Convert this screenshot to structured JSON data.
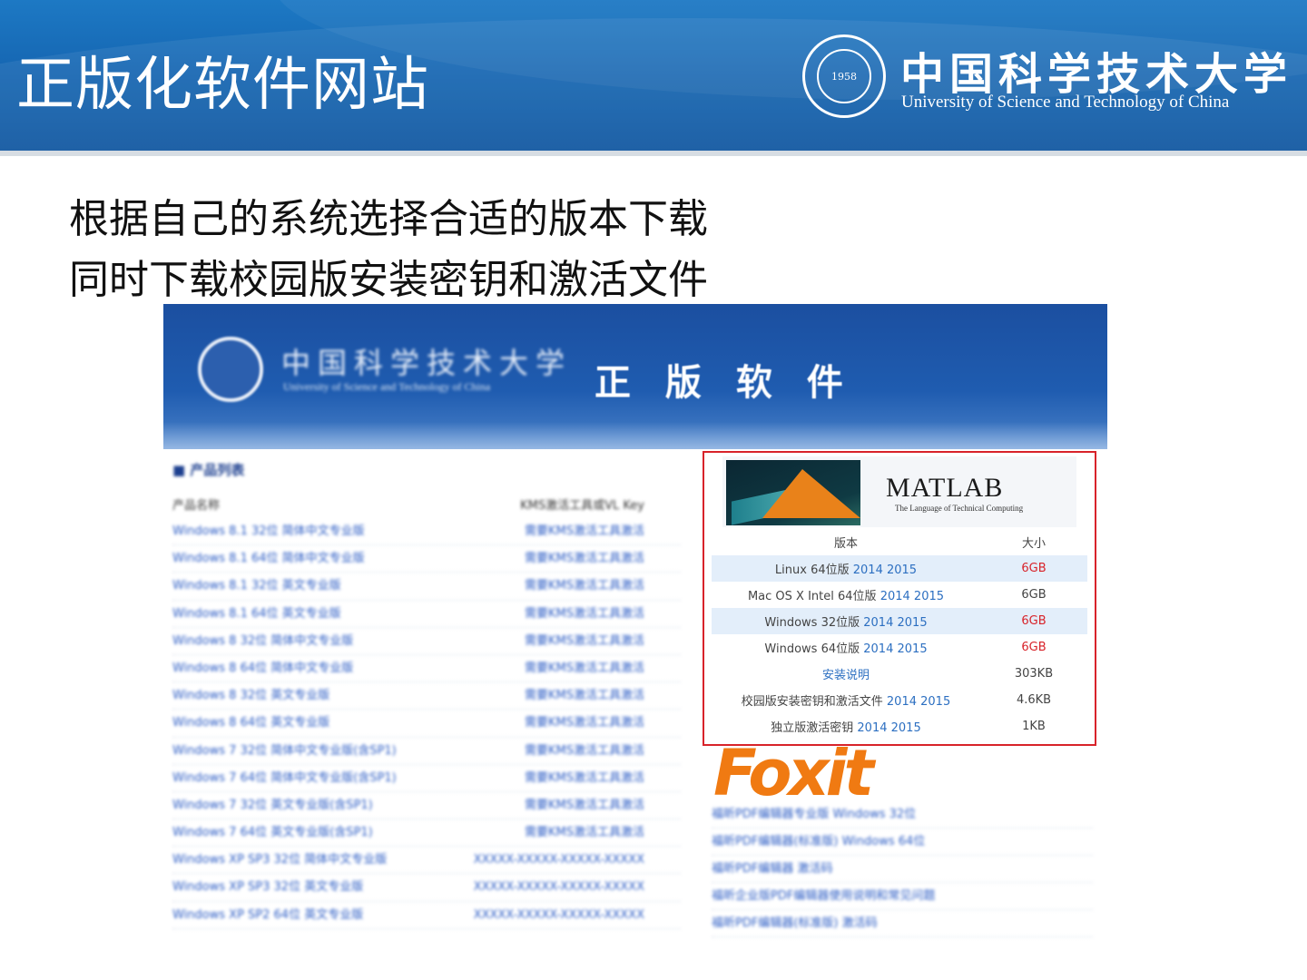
{
  "slide": {
    "title": "正版化软件网站",
    "logo_cn": "中国科学技术大学",
    "logo_en": "University of Science and Technology of China",
    "seal_year": "1958",
    "line1": "根据自己的系统选择合适的版本下载",
    "line2": "同时下载校园版安装密钥和激活文件"
  },
  "site": {
    "name_cn": "中国科学技术大学",
    "name_en": "University of Science and Technology of China",
    "section_title": "正 版 软 件",
    "product_list_heading": "■ 产品列表",
    "col_name": "产品名称",
    "col_key": "KMS激活工具或VL Key",
    "products": [
      {
        "name": "Windows 8.1 32位 简体中文专业版",
        "key": "需要KMS激活工具激活"
      },
      {
        "name": "Windows 8.1 64位 简体中文专业版",
        "key": "需要KMS激活工具激活"
      },
      {
        "name": "Windows 8.1 32位 英文专业版",
        "key": "需要KMS激活工具激活"
      },
      {
        "name": "Windows 8.1 64位 英文专业版",
        "key": "需要KMS激活工具激活"
      },
      {
        "name": "Windows 8 32位 简体中文专业版",
        "key": "需要KMS激活工具激活"
      },
      {
        "name": "Windows 8 64位 简体中文专业版",
        "key": "需要KMS激活工具激活"
      },
      {
        "name": "Windows 8 32位 英文专业版",
        "key": "需要KMS激活工具激活"
      },
      {
        "name": "Windows 8 64位 英文专业版",
        "key": "需要KMS激活工具激活"
      },
      {
        "name": "Windows 7 32位 简体中文专业版(含SP1)",
        "key": "需要KMS激活工具激活"
      },
      {
        "name": "Windows 7 64位 简体中文专业版(含SP1)",
        "key": "需要KMS激活工具激活"
      },
      {
        "name": "Windows 7 32位 英文专业版(含SP1)",
        "key": "需要KMS激活工具激活"
      },
      {
        "name": "Windows 7 64位 英文专业版(含SP1)",
        "key": "需要KMS激活工具激活"
      },
      {
        "name": "Windows XP SP3 32位 简体中文专业版",
        "key": "XXXXX-XXXXX-XXXXX-XXXXX"
      },
      {
        "name": "Windows XP SP3 32位 英文专业版",
        "key": "XXXXX-XXXXX-XXXXX-XXXXX"
      },
      {
        "name": "Windows XP SP2 64位 英文专业版",
        "key": "XXXXX-XXXXX-XXXXX-XXXXX"
      }
    ],
    "matlab": {
      "logo_word": "MATLAB",
      "tagline": "The Language of Technical Computing",
      "col_version": "版本",
      "col_size": "大小",
      "rows": [
        {
          "name": "Linux 64位版",
          "v1": "2014",
          "v2": "2015",
          "size": "6GB",
          "size_red": true,
          "alt": true
        },
        {
          "name": "Mac OS X Intel 64位版",
          "v1": "2014",
          "v2": "2015",
          "size": "6GB",
          "size_red": false,
          "alt": false
        },
        {
          "name": "Windows 32位版",
          "v1": "2014",
          "v2": "2015",
          "size": "6GB",
          "size_red": true,
          "alt": true
        },
        {
          "name": "Windows 64位版",
          "v1": "2014",
          "v2": "2015",
          "size": "6GB",
          "size_red": true,
          "alt": false
        },
        {
          "name": "安装说明",
          "v1": "",
          "v2": "",
          "size": "303KB",
          "size_red": false,
          "alt": false,
          "link": true
        },
        {
          "name": "校园版安装密钥和激活文件",
          "v1": "2014",
          "v2": "2015",
          "size": "4.6KB",
          "size_red": false,
          "alt": false
        },
        {
          "name": "独立版激活密钥",
          "v1": "2014",
          "v2": "2015",
          "size": "1KB",
          "size_red": false,
          "alt": false
        }
      ]
    },
    "foxit": {
      "logo_word": "Foxit",
      "items": [
        "福昕PDF编辑器专业版 Windows 32位",
        "福昕PDF编辑器(标准版) Windows 64位",
        "福昕PDF编辑器 激活码",
        "福昕企业版PDF编辑器使用说明和常见问题",
        "福昕PDF编辑器(标准版) 激活码"
      ]
    }
  }
}
